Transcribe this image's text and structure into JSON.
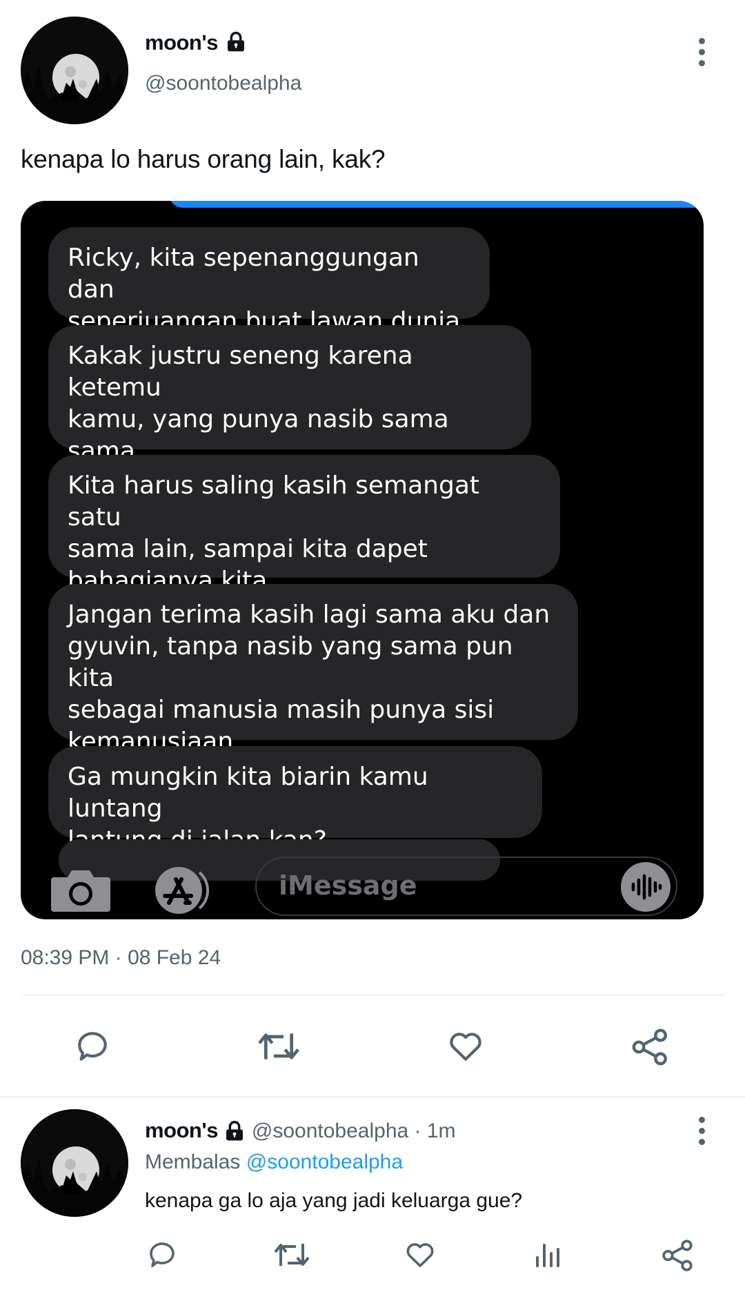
{
  "tweet": {
    "author_name": "moon's",
    "author_handle": "@soontobealpha",
    "text": "kenapa lo harus orang lain, kak?",
    "timestamp": "08:39 PM · 08 Feb 24"
  },
  "screenshot": {
    "messages": [
      "Ricky, kita sepenanggungan dan\nseperjuangan buat lawan dunia",
      "Kakak justru seneng karena ketemu\nkamu, yang punya nasib sama sama\nkakak",
      "Kita harus saling kasih semangat satu\nsama lain, sampai kita dapet\nbahagianya kita",
      "Jangan terima kasih lagi sama aku dan\ngyuvin, tanpa nasib yang sama pun kita\nsebagai manusia masih punya sisi\nkemanusiaan",
      "Ga mungkin kita biarin kamu luntang\nlantung di jalan kan?"
    ],
    "input_placeholder": "iMessage"
  },
  "reply": {
    "author_name": "moon's",
    "meta": "@soontobealpha · 1m",
    "replying_prefix": "Membalas",
    "replying_to": "@soontobealpha",
    "text": "kenapa ga lo aja yang jadi keluarga gue?"
  },
  "icons": {
    "main_actions": [
      "reply-icon",
      "retweet-icon",
      "like-icon",
      "share-icon"
    ],
    "reply_actions": [
      "reply-icon",
      "retweet-icon",
      "like-icon",
      "analytics-icon",
      "share-icon"
    ]
  },
  "colors": {
    "icon_gray": "#536471",
    "mention_blue": "#1d9bf0",
    "bubble_gray": "#262628",
    "imessage_blue": "#1d84f5"
  }
}
